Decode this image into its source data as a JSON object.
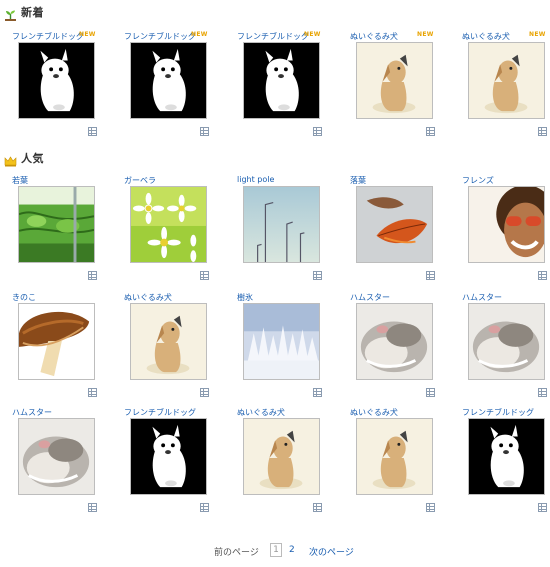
{
  "sections": {
    "new": {
      "title": "新着",
      "items": [
        {
          "label": "フレンチブルドッグ",
          "image": "bulldog",
          "badge": "NEW"
        },
        {
          "label": "フレンチブルドッグ",
          "image": "bulldog",
          "badge": "NEW"
        },
        {
          "label": "フレンチブルドッグ",
          "image": "bulldog",
          "badge": "NEW"
        },
        {
          "label": "ぬいぐるみ犬",
          "image": "plushdog",
          "badge": "NEW"
        },
        {
          "label": "ぬいぐるみ犬",
          "image": "plushdog",
          "badge": "NEW"
        }
      ]
    },
    "popular": {
      "title": "人気",
      "rows": [
        [
          {
            "label": "若葉",
            "image": "leaves"
          },
          {
            "label": "ガーベラ",
            "image": "gerbera"
          },
          {
            "label": "light pole",
            "image": "lightpole"
          },
          {
            "label": "落葉",
            "image": "fallenleaf"
          },
          {
            "label": "フレンズ",
            "image": "friends"
          }
        ],
        [
          {
            "label": "きのこ",
            "image": "mushroom"
          },
          {
            "label": "ぬいぐるみ犬",
            "image": "plushdog"
          },
          {
            "label": "樹氷",
            "image": "frost"
          },
          {
            "label": "ハムスター",
            "image": "hamster"
          },
          {
            "label": "ハムスター",
            "image": "hamster"
          }
        ],
        [
          {
            "label": "ハムスター",
            "image": "hamster"
          },
          {
            "label": "フレンチブルドッグ",
            "image": "bulldog"
          },
          {
            "label": "ぬいぐるみ犬",
            "image": "plushdog"
          },
          {
            "label": "ぬいぐるみ犬",
            "image": "plushdog"
          },
          {
            "label": "フレンチブルドッグ",
            "image": "bulldog"
          }
        ]
      ]
    }
  },
  "pagination": {
    "prev_label": "前のページ",
    "current_page": "1",
    "next_page_number": "2",
    "next_label": "次のページ"
  },
  "colors": {
    "link": "#1a5eb0",
    "badge": "#e8a300",
    "border": "#bdbdbd"
  }
}
